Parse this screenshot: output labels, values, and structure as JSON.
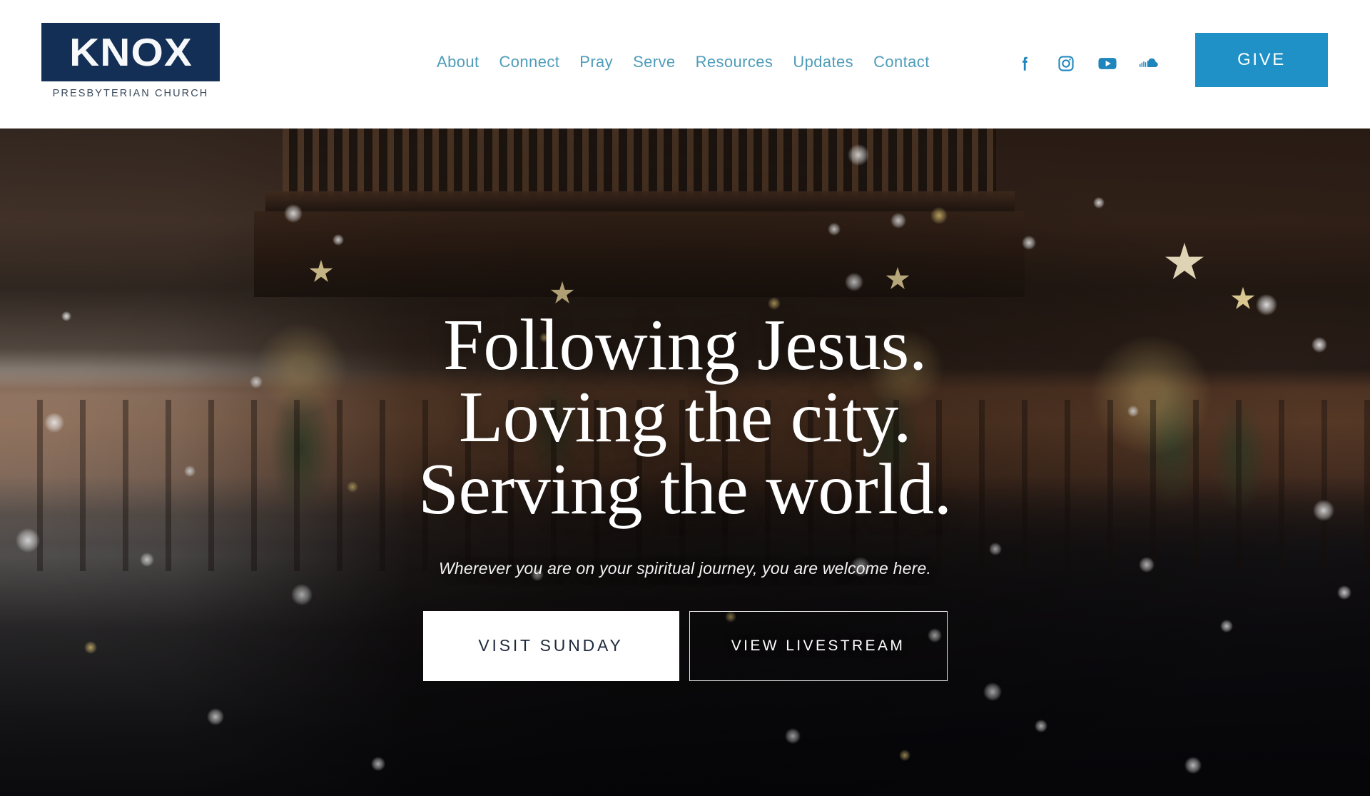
{
  "site": {
    "logo": {
      "word": "KNOX",
      "subtitle": "PRESBYTERIAN CHURCH",
      "box_color": "#132f56"
    }
  },
  "header": {
    "nav": [
      {
        "label": "About"
      },
      {
        "label": "Connect"
      },
      {
        "label": "Pray"
      },
      {
        "label": "Serve"
      },
      {
        "label": "Resources"
      },
      {
        "label": "Updates"
      },
      {
        "label": "Contact"
      }
    ],
    "nav_color": "#4e9cb9",
    "social": [
      {
        "icon": "facebook-icon",
        "label": "Facebook"
      },
      {
        "icon": "instagram-icon",
        "label": "Instagram"
      },
      {
        "icon": "youtube-icon",
        "label": "YouTube"
      },
      {
        "icon": "soundcloud-icon",
        "label": "SoundCloud"
      }
    ],
    "social_color": "#1f85bd",
    "give": {
      "label": "GIVE",
      "bg_color": "#1f91c7",
      "text_color": "#ffffff"
    }
  },
  "hero": {
    "headline_lines": [
      "Following Jesus.",
      "Loving the city.",
      "Serving the world."
    ],
    "subhead": "Wherever you are on your spiritual journey, you are welcome here.",
    "buttons": [
      {
        "label": "VISIT SUNDAY",
        "style": "solid",
        "bg": "#ffffff",
        "fg": "#1d2a3c"
      },
      {
        "label": "VIEW LIVESTREAM",
        "style": "outline",
        "bg": "transparent",
        "fg": "#ffffff"
      }
    ],
    "background_description": "Church sanctuary with pipe organ, wooden balcony, Christmas trees with star toppers, congregation standing, snow bokeh overlay"
  }
}
